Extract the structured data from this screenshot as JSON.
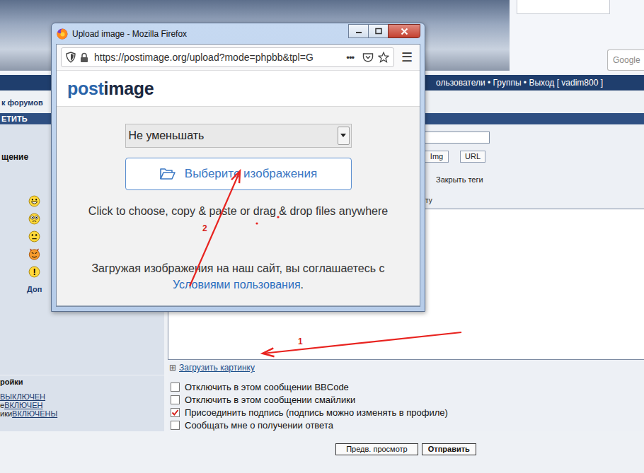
{
  "browser_window": {
    "title": "Upload image - Mozilla Firefox",
    "url": "https://postimage.org/upload?mode=phpbb&tpl=G",
    "page_actions": "•••",
    "menu": "☰"
  },
  "uploader": {
    "logo": {
      "first": "post",
      "second": "image"
    },
    "resize_select": "Не уменьшать",
    "choose_button": "Выберите изображения",
    "hint": "Click to choose, copy & paste or drag & drop files anywhere",
    "terms_text": "Загружая изображения на наш сайт, вы соглашаетесь с",
    "terms_link": "Условиями пользования",
    "terms_end": "."
  },
  "forum": {
    "search_placeholder": "Google",
    "nav_links": "ользователи • Группы • Выход [ vadim800 ]",
    "breadcrumb": "к форумов",
    "table_header": "ЕТИТЬ",
    "message_label": "щение",
    "smilies": [
      {
        "kind": "grin"
      },
      {
        "kind": "eyes"
      },
      {
        "kind": "neutral"
      },
      {
        "kind": "devil"
      },
      {
        "kind": "exclaim",
        "glyph": "!"
      }
    ],
    "more_smilies": "Доп",
    "tag_buttons": [
      "Img",
      "URL"
    ],
    "close_tags": "Закрыть теги",
    "hint_fragment": "сту",
    "upload_icon": "⊞",
    "upload_link": "Загрузить картинку",
    "options_label": "ройки",
    "option_states": [
      {
        "prefix": "",
        "value": "ВЫКЛЮЧЕН"
      },
      {
        "prefix": "е",
        "value": "ВКЛЮЧЕН"
      },
      {
        "prefix": "ики",
        "value": "ВКЛЮЧЕНЫ"
      }
    ],
    "checkboxes": [
      {
        "label": "Отключить в этом сообщении BBCode",
        "checked": false
      },
      {
        "label": "Отключить в этом сообщении смайлики",
        "checked": false
      },
      {
        "label": "Присоединить подпись (подпись можно изменять в профиле)",
        "checked": true
      },
      {
        "label": "Сообщать мне о получении ответа",
        "checked": false
      }
    ],
    "buttons": [
      {
        "label": "Предв. просмотр",
        "primary": false
      },
      {
        "label": "Отправить",
        "primary": true
      }
    ]
  },
  "annotations": [
    {
      "label": "1"
    },
    {
      "label": "2"
    }
  ]
}
